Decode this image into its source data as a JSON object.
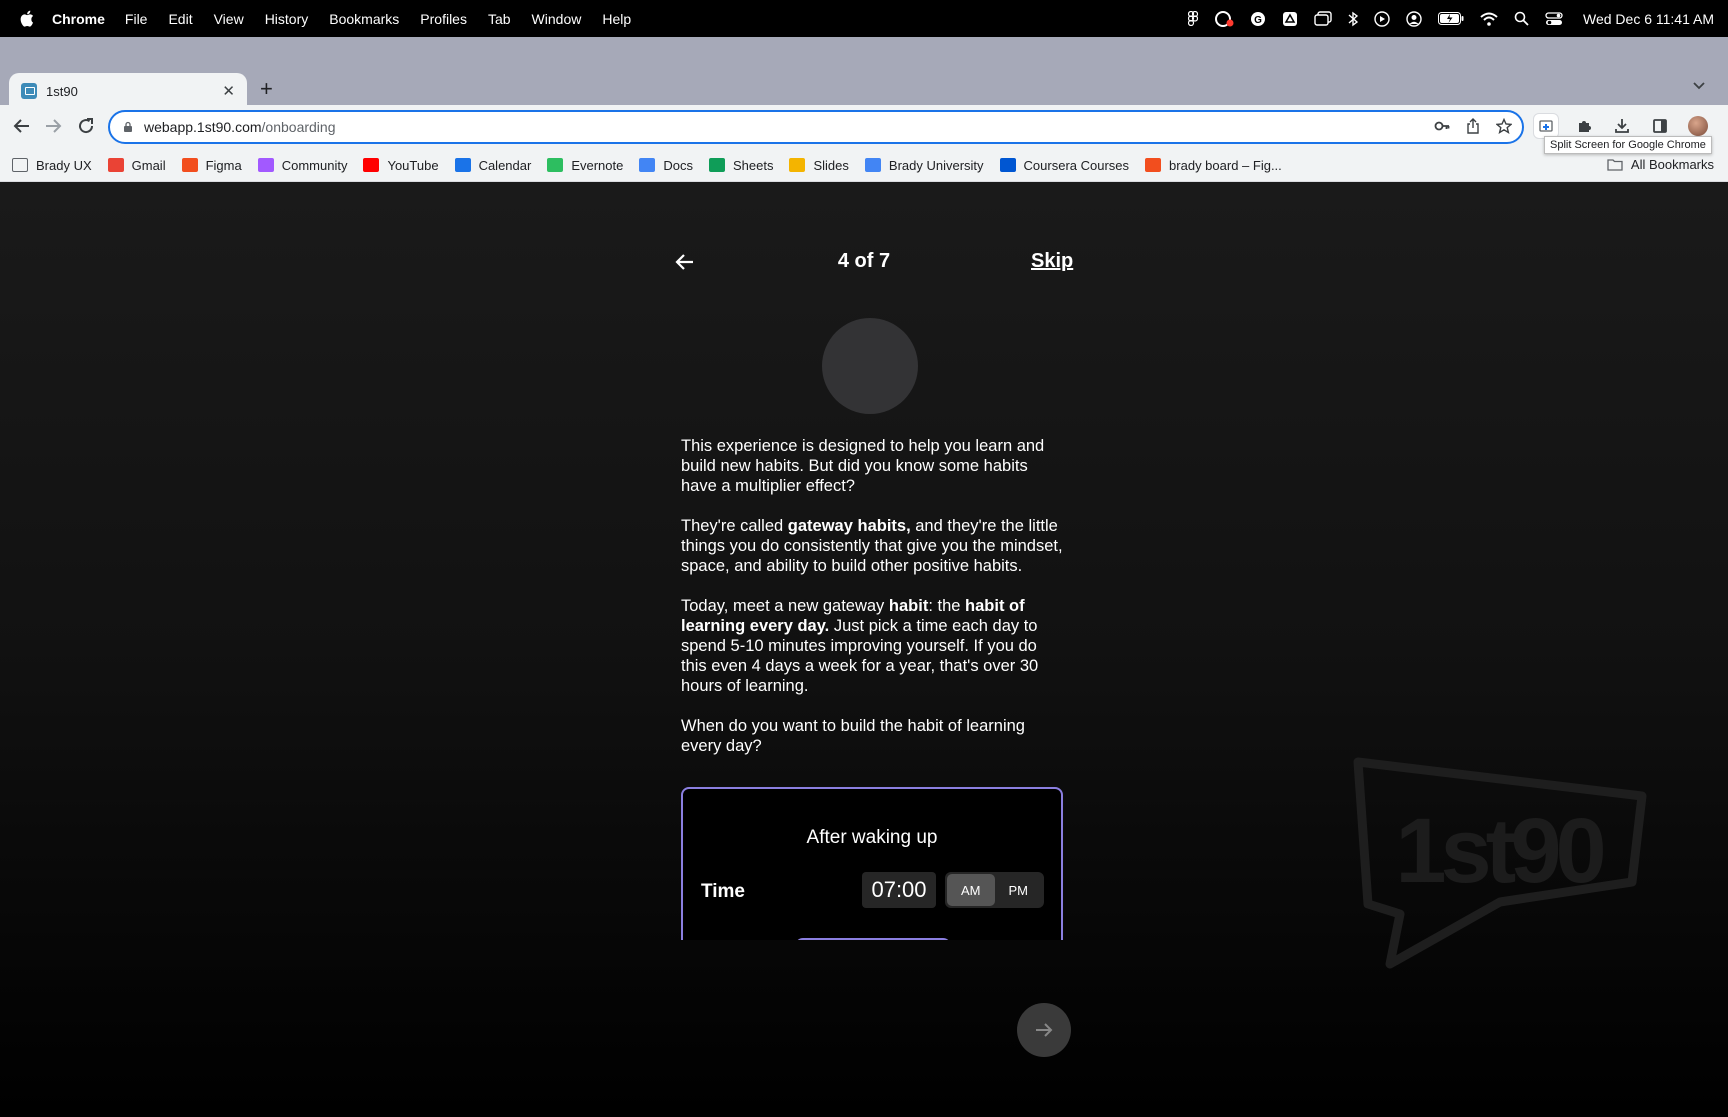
{
  "menubar": {
    "app": "Chrome",
    "items": [
      "File",
      "Edit",
      "View",
      "History",
      "Bookmarks",
      "Profiles",
      "Tab",
      "Window",
      "Help"
    ],
    "clock": "Wed Dec 6  11:41 AM"
  },
  "tab": {
    "title": "1st90"
  },
  "address": {
    "host": "webapp.1st90.com",
    "path": "/onboarding"
  },
  "tooltip": "Split Screen for Google Chrome",
  "bookmarks": [
    {
      "label": "Brady UX",
      "color": "#5f6368"
    },
    {
      "label": "Gmail",
      "color": "#ea4335"
    },
    {
      "label": "Figma",
      "color": "#f24e1e"
    },
    {
      "label": "Community",
      "color": "#a259ff"
    },
    {
      "label": "YouTube",
      "color": "#ff0000"
    },
    {
      "label": "Calendar",
      "color": "#1a73e8"
    },
    {
      "label": "Evernote",
      "color": "#2dbe60"
    },
    {
      "label": "Docs",
      "color": "#4285f4"
    },
    {
      "label": "Sheets",
      "color": "#0f9d58"
    },
    {
      "label": "Slides",
      "color": "#f4b400"
    },
    {
      "label": "Brady University",
      "color": "#4285f4"
    },
    {
      "label": "Coursera Courses",
      "color": "#0056d2"
    },
    {
      "label": "brady board – Fig...",
      "color": "#f24e1e"
    }
  ],
  "bookmarks_all": "All Bookmarks",
  "onboarding": {
    "step": "4 of 7",
    "skip": "Skip",
    "p1": "This experience is designed to help you learn and build new habits. But did you know some habits have a multiplier effect?",
    "p2_a": "They're called ",
    "p2_b": "gateway habits,",
    "p2_c": " and they're the little things you do consistently that give you the mindset, space, and ability to build other positive habits.",
    "p3_a": "Today, meet a new gateway ",
    "p3_b": "habit",
    "p3_c": ": the ",
    "p3_d": "habit of learning every day.",
    "p3_e": " Just pick a time each day to spend 5-10 minutes improving yourself. If you do this even 4 days a week for a year, that's over 30 hours of learning.",
    "p4": "When do you want to build the habit of learning every day?",
    "card": {
      "title": "After waking up",
      "time_label": "Time",
      "time_value": "07:00",
      "am": "AM",
      "pm": "PM"
    },
    "watermark": "1st90"
  },
  "colors": {
    "accent": "#8b7fe0",
    "chrome_blue": "#1a73e8"
  }
}
